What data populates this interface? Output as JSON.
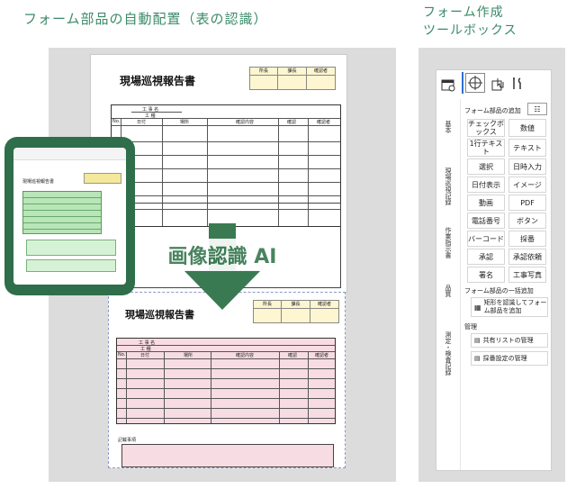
{
  "heading_left": "フォーム部品の自動配置（表の認識）",
  "heading_right_line1": "フォーム作成",
  "heading_right_line2": "ツールボックス",
  "doc_title": "現場巡視報告書",
  "stamp_labels": [
    "所長",
    "課長",
    "確認者"
  ],
  "field_labels": [
    "工 事 名",
    "工 種"
  ],
  "table_headers": [
    "No.",
    "日付",
    "場所",
    "確認内容",
    "確認",
    "確認者"
  ],
  "notes_label": "記載事項",
  "ai_label": "画像認識 AI",
  "toolbox": {
    "add_parts_label": "フォーム部品の追加",
    "vertical_tabs": [
      "基本",
      "現場巡視記録",
      "作業指示書",
      "品質",
      "測定・検査記録"
    ],
    "tools": [
      "チェックボックス",
      "数値",
      "1行テキスト",
      "テキスト",
      "選択",
      "日時入力",
      "日付表示",
      "イメージ",
      "動画",
      "PDF",
      "電話番号",
      "ボタン",
      "バーコード",
      "採番",
      "承認",
      "承認依頼",
      "署名",
      "工事写真"
    ],
    "bulk_add_label": "フォーム部品の一括追加",
    "bulk_add_button": "矩形を認識してフォーム部品を追加",
    "manage_label": "管理",
    "manage_buttons": [
      "共有リストの管理",
      "採番設定の管理"
    ]
  }
}
